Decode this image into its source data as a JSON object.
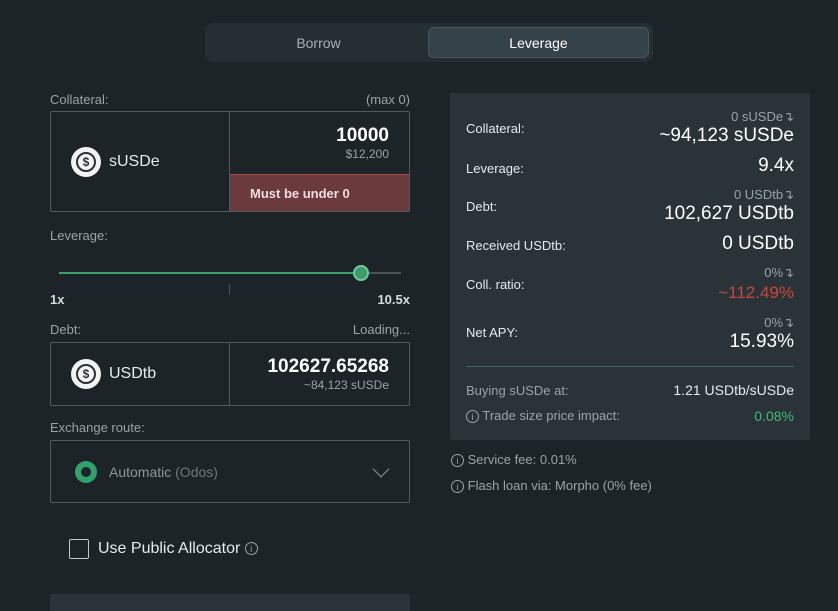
{
  "tabs": [
    {
      "label": "Borrow",
      "active": false
    },
    {
      "label": "Leverage",
      "active": true
    }
  ],
  "collateral": {
    "label": "Collateral:",
    "max": "(max 0)",
    "token": "sUSDe",
    "amount": "10000",
    "usd": "$12,200",
    "error": "Must be under 0"
  },
  "leverage": {
    "label": "Leverage:",
    "min": "1x",
    "max": "10.5x",
    "value": 9.4,
    "min_value": 1,
    "max_value": 10.5
  },
  "debt": {
    "label": "Debt:",
    "status": "Loading...",
    "token": "USDtb",
    "amount": "102627.65268",
    "equiv": "~84,123 sUSDe"
  },
  "route": {
    "label": "Exchange route:",
    "value": "Automatic",
    "sub": "(Odos)"
  },
  "public_allocator": {
    "label": "Use Public Allocator",
    "checked": false
  },
  "summary": {
    "collateral_label": "Collateral:",
    "collateral_prev": "0 sUSDe",
    "collateral_value": "~94,123 sUSDe",
    "leverage_label": "Leverage:",
    "leverage_value": "9.4x",
    "debt_label": "Debt:",
    "debt_prev": "0 USDtb",
    "debt_value": "102,627 USDtb",
    "received_label": "Received USDtb:",
    "received_value": "0 USDtb",
    "ratio_label": "Coll. ratio:",
    "ratio_prev": "0%",
    "ratio_value": "~112.49%",
    "apy_label": "Net APY:",
    "apy_prev": "0%",
    "apy_value": "15.93%",
    "buying_label": "Buying sUSDe at:",
    "buying_value": "1.21 USDtb/sUSDe",
    "impact_label": "Trade size price impact:",
    "impact_value": "0.08%"
  },
  "notes": {
    "service_fee": "Service fee: 0.01%",
    "flash_loan": "Flash loan via: Morpho (0% fee)"
  },
  "colors": {
    "accent": "#3f9a6d",
    "error": "#c7473d",
    "positive": "#3fb97a"
  },
  "icons": {
    "arrow": "↴",
    "info": "i",
    "dollar": "$"
  }
}
